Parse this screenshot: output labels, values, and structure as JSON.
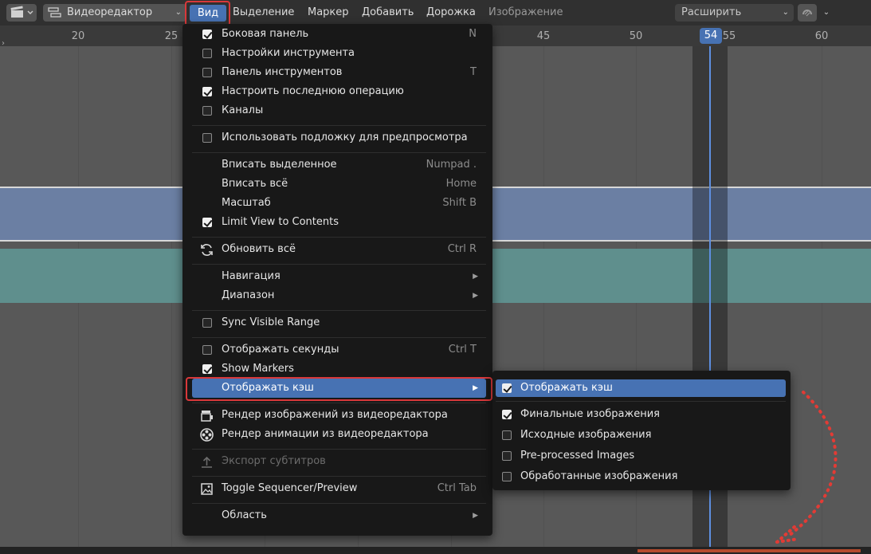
{
  "header": {
    "editor_type_icon": "clapper-icon",
    "sequencer_mode_icon": "sequencer-strips-icon",
    "sequencer_mode": "Видеоредактор",
    "menus": [
      "Вид",
      "Выделение",
      "Маркер",
      "Добавить",
      "Дорожка",
      "Изображение"
    ],
    "overlap_mode": "Расширить",
    "snap_icon": "magnet-icon"
  },
  "ruler": {
    "ticks": [
      "20",
      "25",
      "45",
      "50",
      "55",
      "60"
    ],
    "current_frame": "54"
  },
  "view_menu": {
    "items": [
      {
        "label": "Боковая панель",
        "checkbox": true,
        "checked": true,
        "shortcut": "N"
      },
      {
        "label": "Настройки инструмента",
        "checkbox": true,
        "checked": false,
        "shortcut": ""
      },
      {
        "label": "Панель инструментов",
        "checkbox": true,
        "checked": false,
        "shortcut": "T"
      },
      {
        "label": "Настроить последнюю операцию",
        "checkbox": true,
        "checked": true,
        "shortcut": ""
      },
      {
        "label": "Каналы",
        "checkbox": true,
        "checked": false,
        "shortcut": ""
      },
      {
        "label": "Использовать подложку для предпросмотра",
        "checkbox": true,
        "checked": false,
        "shortcut": ""
      },
      {
        "label": "Вписать выделенное",
        "shortcut": "Numpad ."
      },
      {
        "label": "Вписать всё",
        "shortcut": "Home"
      },
      {
        "label": "Масштаб",
        "shortcut": "Shift B"
      },
      {
        "label": "Limit View to Contents",
        "checkbox": true,
        "checked": true,
        "shortcut": ""
      },
      {
        "label": "Обновить всё",
        "icon": "refresh-icon",
        "shortcut": "Ctrl R"
      },
      {
        "label": "Навигация",
        "submenu": true
      },
      {
        "label": "Диапазон",
        "submenu": true
      },
      {
        "label": "Sync Visible Range",
        "checkbox": true,
        "checked": false
      },
      {
        "label": "Отображать секунды",
        "checkbox": true,
        "checked": false,
        "shortcut": "Ctrl T"
      },
      {
        "label": "Show Markers",
        "checkbox": true,
        "checked": true
      },
      {
        "label": "Отображать кэш",
        "submenu": true,
        "active": true
      },
      {
        "label": "Рендер изображений из видеоредактора",
        "icon": "render-still-icon"
      },
      {
        "label": "Рендер анимации из видеоредактора",
        "icon": "render-animation-icon"
      },
      {
        "label": "Экспорт субтитров",
        "icon": "export-icon",
        "disabled": true
      },
      {
        "label": "Toggle Sequencer/Preview",
        "icon": "image-icon",
        "shortcut": "Ctrl Tab"
      },
      {
        "label": "Область",
        "submenu": true
      }
    ]
  },
  "cache_submenu": {
    "items": [
      {
        "label": "Отображать кэш",
        "checked": true,
        "active": true
      },
      {
        "label": "Финальные изображения",
        "checked": true
      },
      {
        "label": "Исходные изображения",
        "checked": false
      },
      {
        "label": "Pre-processed Images",
        "checked": false
      },
      {
        "label": "Обработанные изображения",
        "checked": false
      }
    ]
  },
  "colors": {
    "accent": "#4772b3",
    "highlight_box": "#d9383a",
    "strip_blue": "#6b7fa3",
    "strip_teal": "#5f8f8d",
    "cache_bar": "#b44a2c"
  }
}
